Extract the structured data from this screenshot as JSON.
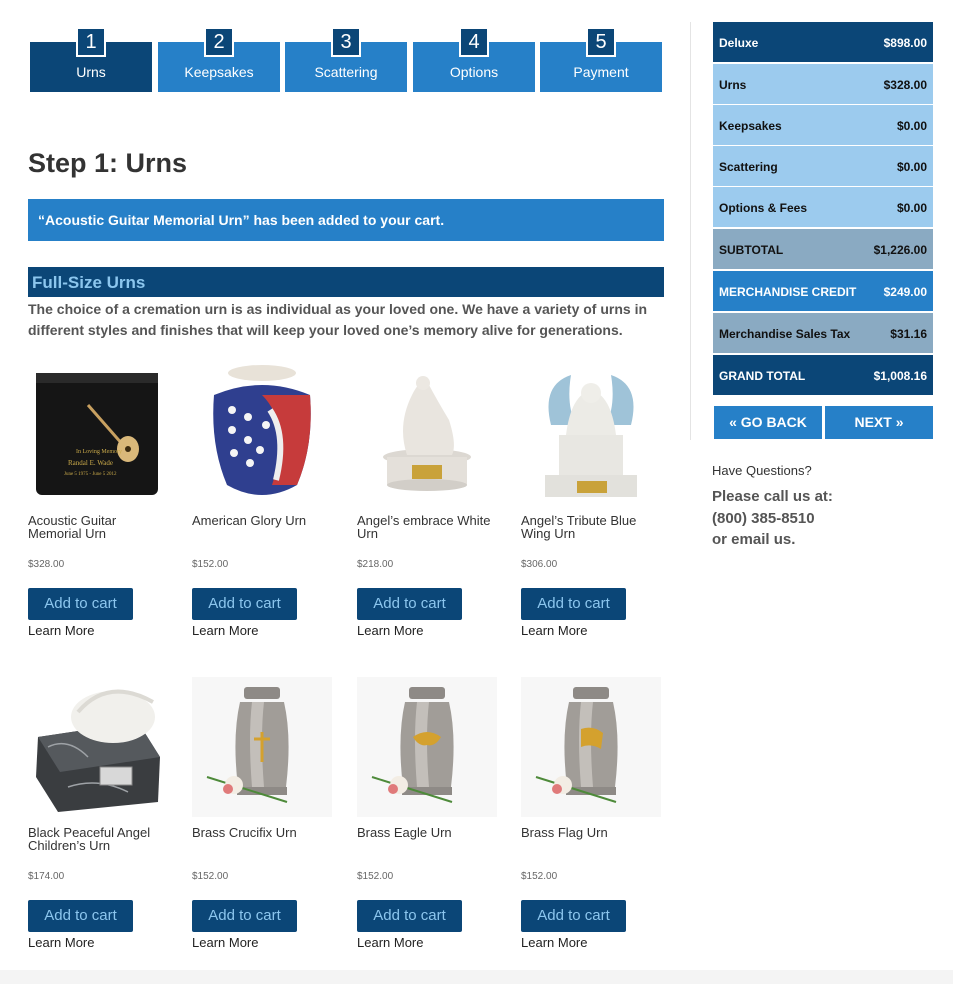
{
  "steps": [
    {
      "num": "1",
      "label": "Urns"
    },
    {
      "num": "2",
      "label": "Keepsakes"
    },
    {
      "num": "3",
      "label": "Scattering"
    },
    {
      "num": "4",
      "label": "Options"
    },
    {
      "num": "5",
      "label": "Payment"
    }
  ],
  "page_title": "Step 1: Urns",
  "notice": "“Acoustic Guitar Memorial Urn” has been added to your cart.",
  "section": {
    "title": "Full-Size Urns",
    "intro": "The choice of a cremation urn is as individual as your loved one.  We have a variety of urns in different styles and finishes that will keep your loved one’s memory alive for generations."
  },
  "products": [
    {
      "name": "Acoustic Guitar Memorial Urn",
      "price": "$328.00",
      "image": "black-guitar-urn-image"
    },
    {
      "name": "American Glory Urn",
      "price": "$152.00",
      "image": "flag-urn-image"
    },
    {
      "name": "Angel’s embrace White Urn",
      "price": "$218.00",
      "image": "pieta-statue-urn-image"
    },
    {
      "name": "Angel’s Tribute Blue Wing Urn",
      "price": "$306.00",
      "image": "angel-statue-urn-image"
    },
    {
      "name": "Black Peaceful Angel Children’s Urn",
      "price": "$174.00",
      "image": "marble-angel-urn-image"
    },
    {
      "name": "Brass Crucifix Urn",
      "price": "$152.00",
      "image": "pewter-urn-image"
    },
    {
      "name": "Brass Eagle Urn",
      "price": "$152.00",
      "image": "pewter-urn-image"
    },
    {
      "name": "Brass Flag Urn",
      "price": "$152.00",
      "image": "pewter-urn-image"
    }
  ],
  "add_to_cart_label": "Add to cart",
  "learn_more_label": "Learn More",
  "summary": {
    "rows": [
      {
        "label": "Deluxe",
        "value": "$898.00"
      },
      {
        "label": "Urns",
        "value": "$328.00"
      },
      {
        "label": "Keepsakes",
        "value": "$0.00"
      },
      {
        "label": "Scattering",
        "value": "$0.00"
      },
      {
        "label": "Options & Fees",
        "value": "$0.00"
      },
      {
        "label": "SUBTOTAL",
        "value": "$1,226.00"
      },
      {
        "label": "MERCHANDISE CREDIT",
        "value": "$249.00"
      },
      {
        "label": "Merchandise Sales Tax",
        "value": "$31.16"
      },
      {
        "label": "GRAND TOTAL",
        "value": "$1,008.16"
      }
    ]
  },
  "nav": {
    "back": "« GO BACK",
    "next": "NEXT »"
  },
  "questions": "Have Questions?",
  "call": {
    "line1": "Please call us at:",
    "phone": "(800) 385-8510",
    "line3": "or email us."
  },
  "colors": {
    "primary_dark": "#0b4677",
    "primary": "#2680c8",
    "light": "#9ccbee",
    "grey_blue": "#8aaac2"
  }
}
